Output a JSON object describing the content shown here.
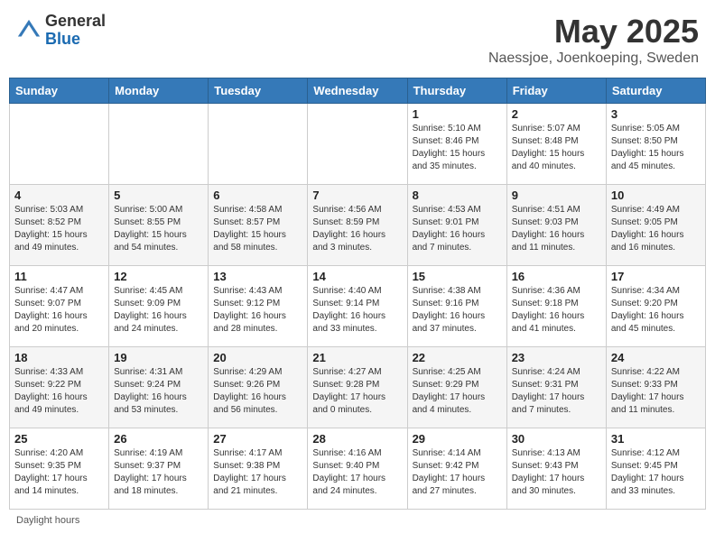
{
  "header": {
    "logo_general": "General",
    "logo_blue": "Blue",
    "title": "May 2025",
    "subtitle": "Naessjoe, Joenkoeping, Sweden"
  },
  "weekdays": [
    "Sunday",
    "Monday",
    "Tuesday",
    "Wednesday",
    "Thursday",
    "Friday",
    "Saturday"
  ],
  "footer": {
    "daylight_label": "Daylight hours"
  },
  "weeks": [
    [
      {
        "day": "",
        "info": ""
      },
      {
        "day": "",
        "info": ""
      },
      {
        "day": "",
        "info": ""
      },
      {
        "day": "",
        "info": ""
      },
      {
        "day": "1",
        "info": "Sunrise: 5:10 AM\nSunset: 8:46 PM\nDaylight: 15 hours\nand 35 minutes."
      },
      {
        "day": "2",
        "info": "Sunrise: 5:07 AM\nSunset: 8:48 PM\nDaylight: 15 hours\nand 40 minutes."
      },
      {
        "day": "3",
        "info": "Sunrise: 5:05 AM\nSunset: 8:50 PM\nDaylight: 15 hours\nand 45 minutes."
      }
    ],
    [
      {
        "day": "4",
        "info": "Sunrise: 5:03 AM\nSunset: 8:52 PM\nDaylight: 15 hours\nand 49 minutes."
      },
      {
        "day": "5",
        "info": "Sunrise: 5:00 AM\nSunset: 8:55 PM\nDaylight: 15 hours\nand 54 minutes."
      },
      {
        "day": "6",
        "info": "Sunrise: 4:58 AM\nSunset: 8:57 PM\nDaylight: 15 hours\nand 58 minutes."
      },
      {
        "day": "7",
        "info": "Sunrise: 4:56 AM\nSunset: 8:59 PM\nDaylight: 16 hours\nand 3 minutes."
      },
      {
        "day": "8",
        "info": "Sunrise: 4:53 AM\nSunset: 9:01 PM\nDaylight: 16 hours\nand 7 minutes."
      },
      {
        "day": "9",
        "info": "Sunrise: 4:51 AM\nSunset: 9:03 PM\nDaylight: 16 hours\nand 11 minutes."
      },
      {
        "day": "10",
        "info": "Sunrise: 4:49 AM\nSunset: 9:05 PM\nDaylight: 16 hours\nand 16 minutes."
      }
    ],
    [
      {
        "day": "11",
        "info": "Sunrise: 4:47 AM\nSunset: 9:07 PM\nDaylight: 16 hours\nand 20 minutes."
      },
      {
        "day": "12",
        "info": "Sunrise: 4:45 AM\nSunset: 9:09 PM\nDaylight: 16 hours\nand 24 minutes."
      },
      {
        "day": "13",
        "info": "Sunrise: 4:43 AM\nSunset: 9:12 PM\nDaylight: 16 hours\nand 28 minutes."
      },
      {
        "day": "14",
        "info": "Sunrise: 4:40 AM\nSunset: 9:14 PM\nDaylight: 16 hours\nand 33 minutes."
      },
      {
        "day": "15",
        "info": "Sunrise: 4:38 AM\nSunset: 9:16 PM\nDaylight: 16 hours\nand 37 minutes."
      },
      {
        "day": "16",
        "info": "Sunrise: 4:36 AM\nSunset: 9:18 PM\nDaylight: 16 hours\nand 41 minutes."
      },
      {
        "day": "17",
        "info": "Sunrise: 4:34 AM\nSunset: 9:20 PM\nDaylight: 16 hours\nand 45 minutes."
      }
    ],
    [
      {
        "day": "18",
        "info": "Sunrise: 4:33 AM\nSunset: 9:22 PM\nDaylight: 16 hours\nand 49 minutes."
      },
      {
        "day": "19",
        "info": "Sunrise: 4:31 AM\nSunset: 9:24 PM\nDaylight: 16 hours\nand 53 minutes."
      },
      {
        "day": "20",
        "info": "Sunrise: 4:29 AM\nSunset: 9:26 PM\nDaylight: 16 hours\nand 56 minutes."
      },
      {
        "day": "21",
        "info": "Sunrise: 4:27 AM\nSunset: 9:28 PM\nDaylight: 17 hours\nand 0 minutes."
      },
      {
        "day": "22",
        "info": "Sunrise: 4:25 AM\nSunset: 9:29 PM\nDaylight: 17 hours\nand 4 minutes."
      },
      {
        "day": "23",
        "info": "Sunrise: 4:24 AM\nSunset: 9:31 PM\nDaylight: 17 hours\nand 7 minutes."
      },
      {
        "day": "24",
        "info": "Sunrise: 4:22 AM\nSunset: 9:33 PM\nDaylight: 17 hours\nand 11 minutes."
      }
    ],
    [
      {
        "day": "25",
        "info": "Sunrise: 4:20 AM\nSunset: 9:35 PM\nDaylight: 17 hours\nand 14 minutes."
      },
      {
        "day": "26",
        "info": "Sunrise: 4:19 AM\nSunset: 9:37 PM\nDaylight: 17 hours\nand 18 minutes."
      },
      {
        "day": "27",
        "info": "Sunrise: 4:17 AM\nSunset: 9:38 PM\nDaylight: 17 hours\nand 21 minutes."
      },
      {
        "day": "28",
        "info": "Sunrise: 4:16 AM\nSunset: 9:40 PM\nDaylight: 17 hours\nand 24 minutes."
      },
      {
        "day": "29",
        "info": "Sunrise: 4:14 AM\nSunset: 9:42 PM\nDaylight: 17 hours\nand 27 minutes."
      },
      {
        "day": "30",
        "info": "Sunrise: 4:13 AM\nSunset: 9:43 PM\nDaylight: 17 hours\nand 30 minutes."
      },
      {
        "day": "31",
        "info": "Sunrise: 4:12 AM\nSunset: 9:45 PM\nDaylight: 17 hours\nand 33 minutes."
      }
    ]
  ]
}
